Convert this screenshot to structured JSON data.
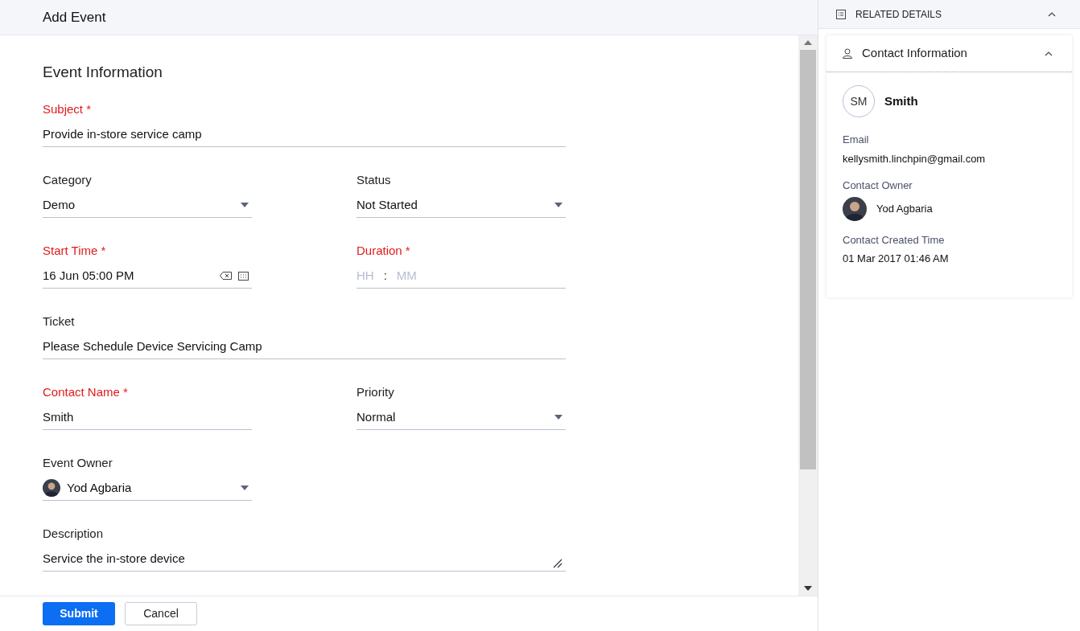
{
  "header": {
    "title": "Add Event"
  },
  "form": {
    "section_title": "Event Information",
    "rows": [
      [
        {
          "kind": "text",
          "label": "Subject",
          "required": true,
          "value": "Provide in-store service camp",
          "wide": true
        }
      ],
      [
        {
          "kind": "select",
          "label": "Category",
          "required": false,
          "value": "Demo",
          "wide": false
        },
        {
          "kind": "select",
          "label": "Status",
          "required": false,
          "value": "Not Started",
          "wide": false
        }
      ],
      [
        {
          "kind": "datetime",
          "label": "Start Time",
          "required": true,
          "value": "16 Jun 05:00 PM",
          "wide": false
        },
        {
          "kind": "duration",
          "label": "Duration",
          "required": true,
          "hours_placeholder": "HH",
          "separator": ":",
          "minutes_placeholder": "MM",
          "wide": false
        }
      ],
      [
        {
          "kind": "text",
          "label": "Ticket",
          "required": false,
          "value": "Please Schedule Device Servicing Camp",
          "wide": true
        }
      ],
      [
        {
          "kind": "text",
          "label": "Contact Name",
          "required": true,
          "value": "Smith",
          "wide": false
        },
        {
          "kind": "select",
          "label": "Priority",
          "required": false,
          "value": "Normal",
          "wide": false
        }
      ],
      [
        {
          "kind": "user",
          "label": "Event Owner",
          "required": false,
          "value": "Yod Agbaria",
          "wide": false
        }
      ],
      [
        {
          "kind": "textarea",
          "label": "Description",
          "required": false,
          "value": "Service the in-store device",
          "wide": true
        }
      ]
    ],
    "required_mark": "*"
  },
  "footer": {
    "buttons": [
      {
        "label": "Submit",
        "kind": "primary"
      },
      {
        "label": "Cancel",
        "kind": "secondary"
      }
    ]
  },
  "related": {
    "title": "RELATED DETAILS",
    "expanded": true,
    "card": {
      "title": "Contact Information",
      "expanded": true,
      "initials": "SM",
      "name": "Smith",
      "details": [
        {
          "kind": "text",
          "label": "Email",
          "value": "kellysmith.linchpin@gmail.com"
        },
        {
          "kind": "user",
          "label": "Contact Owner",
          "value": "Yod Agbaria"
        },
        {
          "kind": "text",
          "label": "Contact Created Time",
          "value": "01 Mar 2017 01:46 AM"
        }
      ]
    }
  }
}
